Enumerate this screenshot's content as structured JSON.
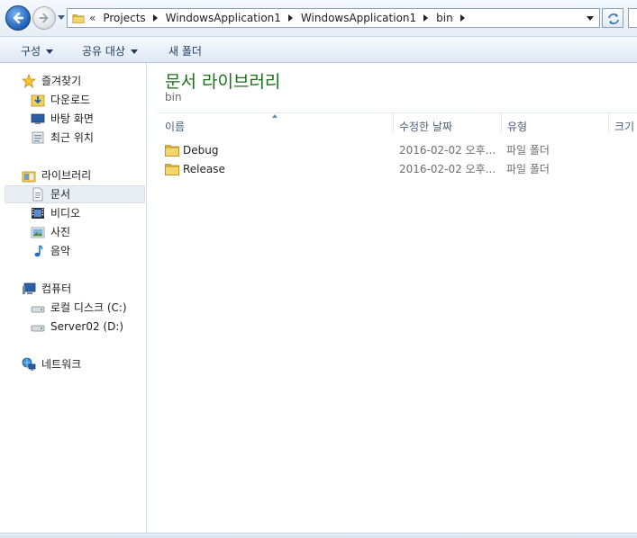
{
  "address": {
    "overflow": "«",
    "crumbs": [
      "Projects",
      "WindowsApplication1",
      "WindowsApplication1",
      "bin"
    ]
  },
  "toolbar": {
    "organize": "구성",
    "share": "공유 대상",
    "new_folder": "새 폴더"
  },
  "nav": {
    "favorites": "즐겨찾기",
    "downloads": "다운로드",
    "desktop": "바탕 화면",
    "recent": "최근 위치",
    "libraries": "라이브러리",
    "documents": "문서",
    "videos": "비디오",
    "pictures": "사진",
    "music": "음악",
    "computer": "컴퓨터",
    "local_disk": "로컬 디스크 (C:)",
    "server_disk": "Server02 (D:)",
    "network": "네트워크"
  },
  "content": {
    "title": "문서 라이브러리",
    "subtitle": "bin",
    "columns": {
      "name": "이름",
      "date": "수정한 날짜",
      "type": "유형",
      "size": "크기"
    },
    "rows": [
      {
        "name": "Debug",
        "date": "2016-02-02 오후...",
        "type": "파일 폴더"
      },
      {
        "name": "Release",
        "date": "2016-02-02 오후...",
        "type": "파일 폴더"
      }
    ]
  },
  "colors": {
    "title_green": "#1e6e1e",
    "selection": "#e9eef4"
  }
}
